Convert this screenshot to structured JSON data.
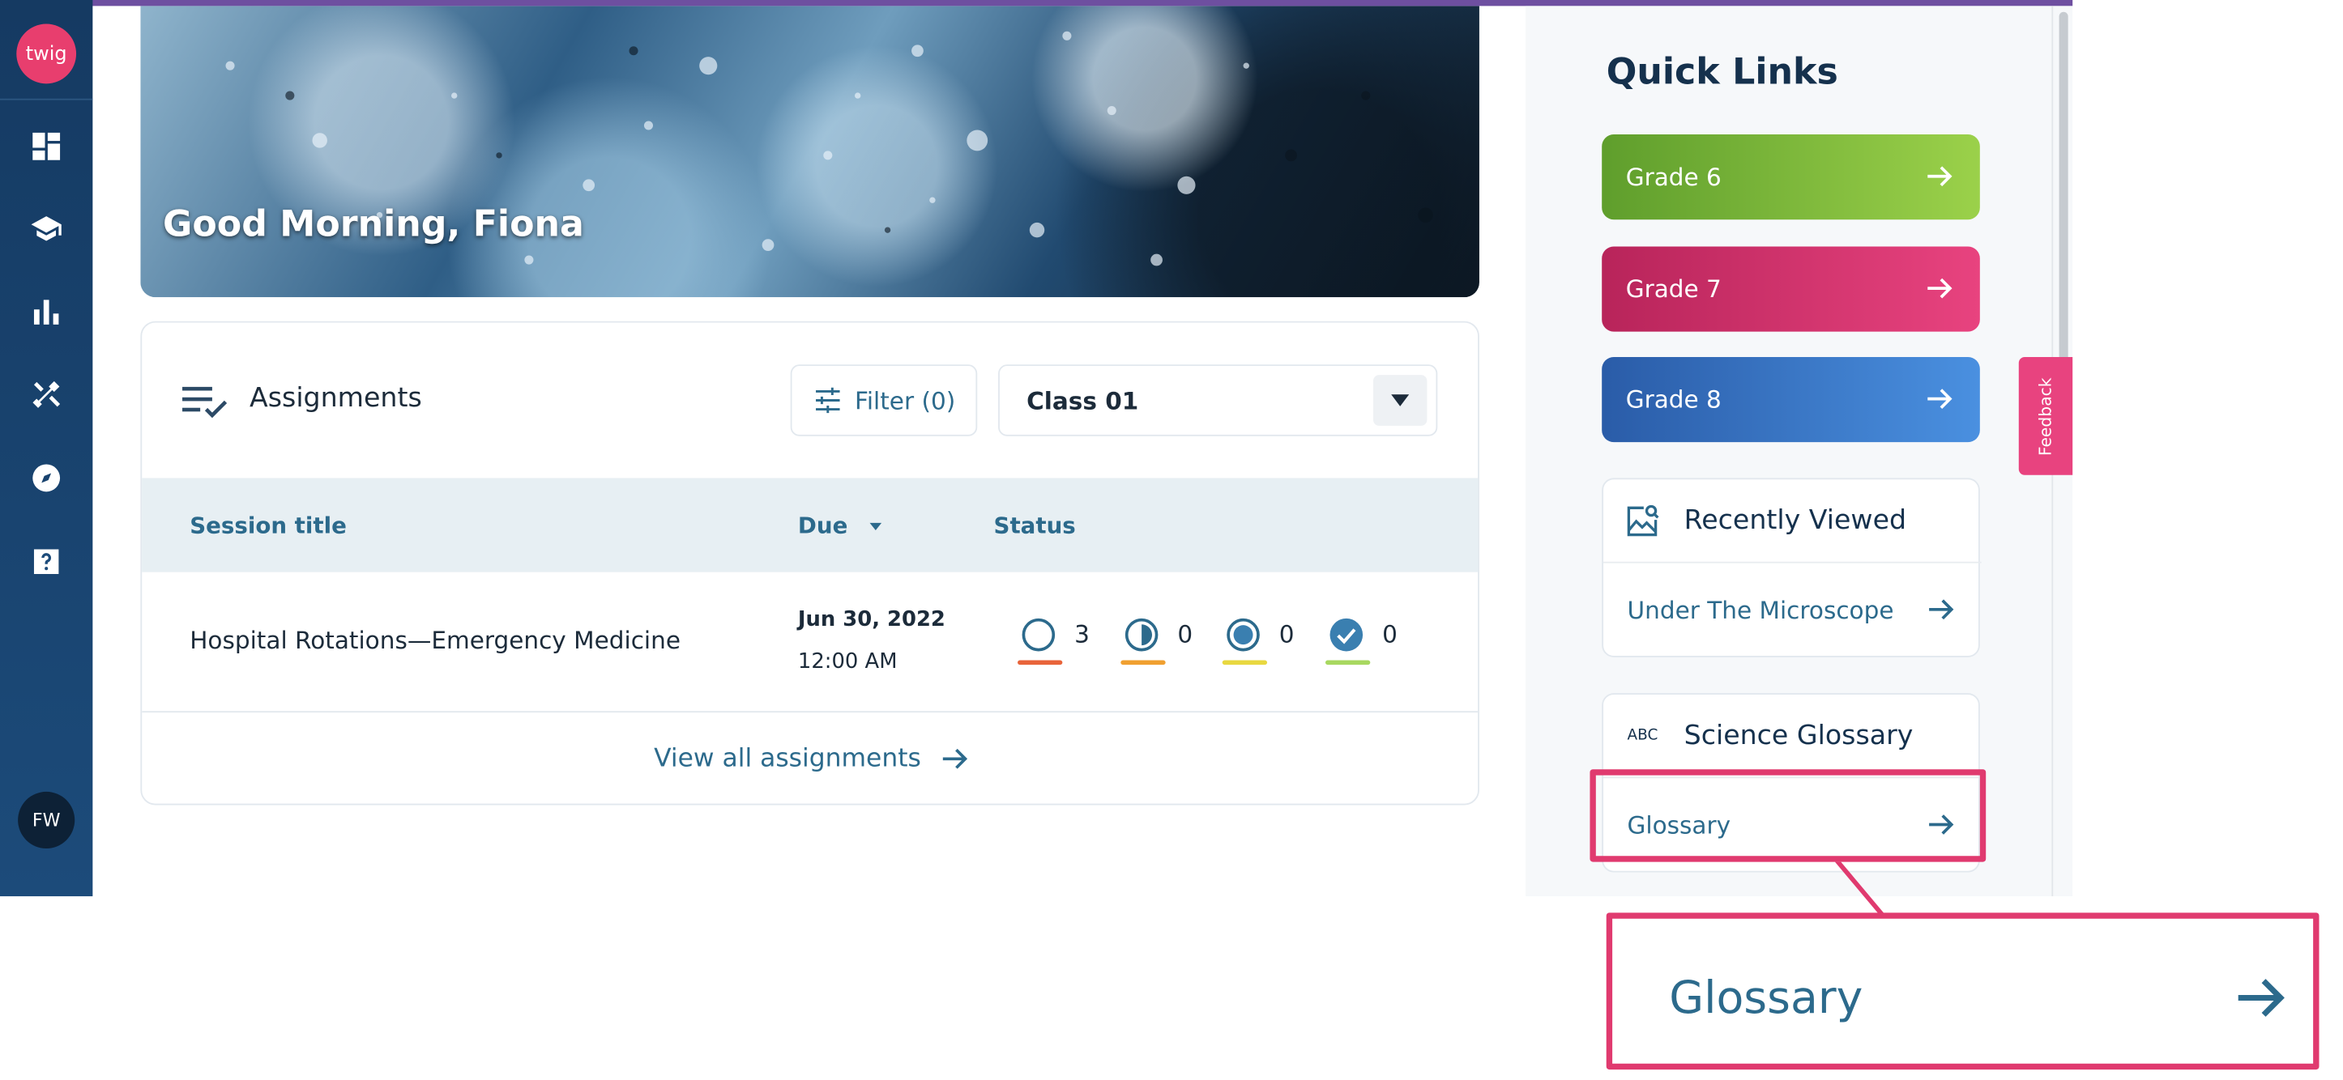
{
  "sidebar": {
    "logo_text": "twig",
    "avatar_initials": "FW",
    "nav_icons": [
      "dashboard-icon",
      "graduation-cap-icon",
      "bar-chart-icon",
      "tools-icon",
      "compass-icon",
      "help-icon"
    ]
  },
  "hero": {
    "greeting": "Good Morning, Fiona"
  },
  "assignments": {
    "title": "Assignments",
    "filter_label": "Filter (0)",
    "class_select_value": "Class 01",
    "columns": {
      "session_title": "Session title",
      "due": "Due",
      "status": "Status"
    },
    "rows": [
      {
        "session": "Hospital Rotations—Emergency Medicine",
        "due_date": "Jun 30, 2022",
        "due_time": "12:00 AM",
        "status_counts": [
          "3",
          "0",
          "0",
          "0"
        ]
      }
    ],
    "view_all_label": "View all assignments"
  },
  "quick_links": {
    "title": "Quick Links",
    "grades": [
      "Grade 6",
      "Grade 7",
      "Grade 8"
    ],
    "recently_viewed": {
      "title": "Recently Viewed",
      "link": "Under The Microscope"
    },
    "science_glossary": {
      "abc": "ABC",
      "title": "Science Glossary",
      "link": "Glossary"
    }
  },
  "feedback_label": "Feedback",
  "zoom_callout_label": "Glossary",
  "colors": {
    "sidebar": "#153a62",
    "accent_link": "#2c6a8c",
    "highlight": "#e03a6f",
    "grade6": "#7ab83a",
    "grade7": "#d2336c",
    "grade8": "#3a78c8",
    "status_not_started": "#e8643a",
    "status_in_progress": "#f0a030",
    "status_submitted": "#e8d840",
    "status_completed": "#a8d860"
  }
}
